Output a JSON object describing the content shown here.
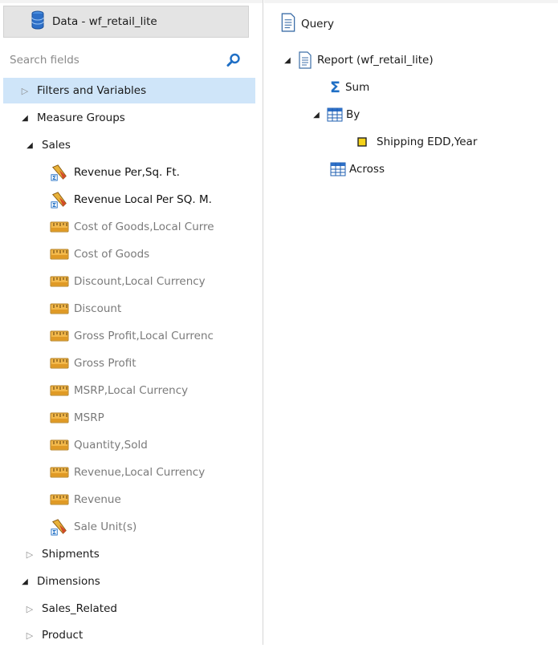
{
  "data_panel": {
    "title": "Data - wf_retail_lite",
    "search_placeholder": "Search fields",
    "filters_label": "Filters and Variables",
    "measure_groups_label": "Measure Groups",
    "sales_label": "Sales",
    "fields": [
      {
        "label": "Revenue Per,Sq. Ft.",
        "kind": "computed"
      },
      {
        "label": "Revenue Local Per SQ. M.",
        "kind": "computed"
      },
      {
        "label": "Cost of Goods,Local Curre",
        "kind": "measure"
      },
      {
        "label": "Cost of Goods",
        "kind": "measure"
      },
      {
        "label": "Discount,Local Currency",
        "kind": "measure"
      },
      {
        "label": "Discount",
        "kind": "measure"
      },
      {
        "label": "Gross Profit,Local Currenc",
        "kind": "measure"
      },
      {
        "label": "Gross Profit",
        "kind": "measure"
      },
      {
        "label": "MSRP,Local Currency",
        "kind": "measure"
      },
      {
        "label": "MSRP",
        "kind": "measure"
      },
      {
        "label": "Quantity,Sold",
        "kind": "measure"
      },
      {
        "label": "Revenue,Local Currency",
        "kind": "measure"
      },
      {
        "label": "Revenue",
        "kind": "measure"
      },
      {
        "label": "Sale Unit(s)",
        "kind": "computed-dim"
      }
    ],
    "shipments_label": "Shipments",
    "dimensions_label": "Dimensions",
    "sales_related_label": "Sales_Related",
    "product_label": "Product"
  },
  "query_panel": {
    "title": "Query",
    "report_label": "Report (wf_retail_lite)",
    "sum_label": "Sum",
    "by_label": "By",
    "by_field_label": "Shipping EDD,Year",
    "across_label": "Across"
  },
  "colors": {
    "selected_row": "#cfe5f9",
    "dim_text": "#7a7a7a",
    "accent_blue": "#1f6fc5"
  }
}
